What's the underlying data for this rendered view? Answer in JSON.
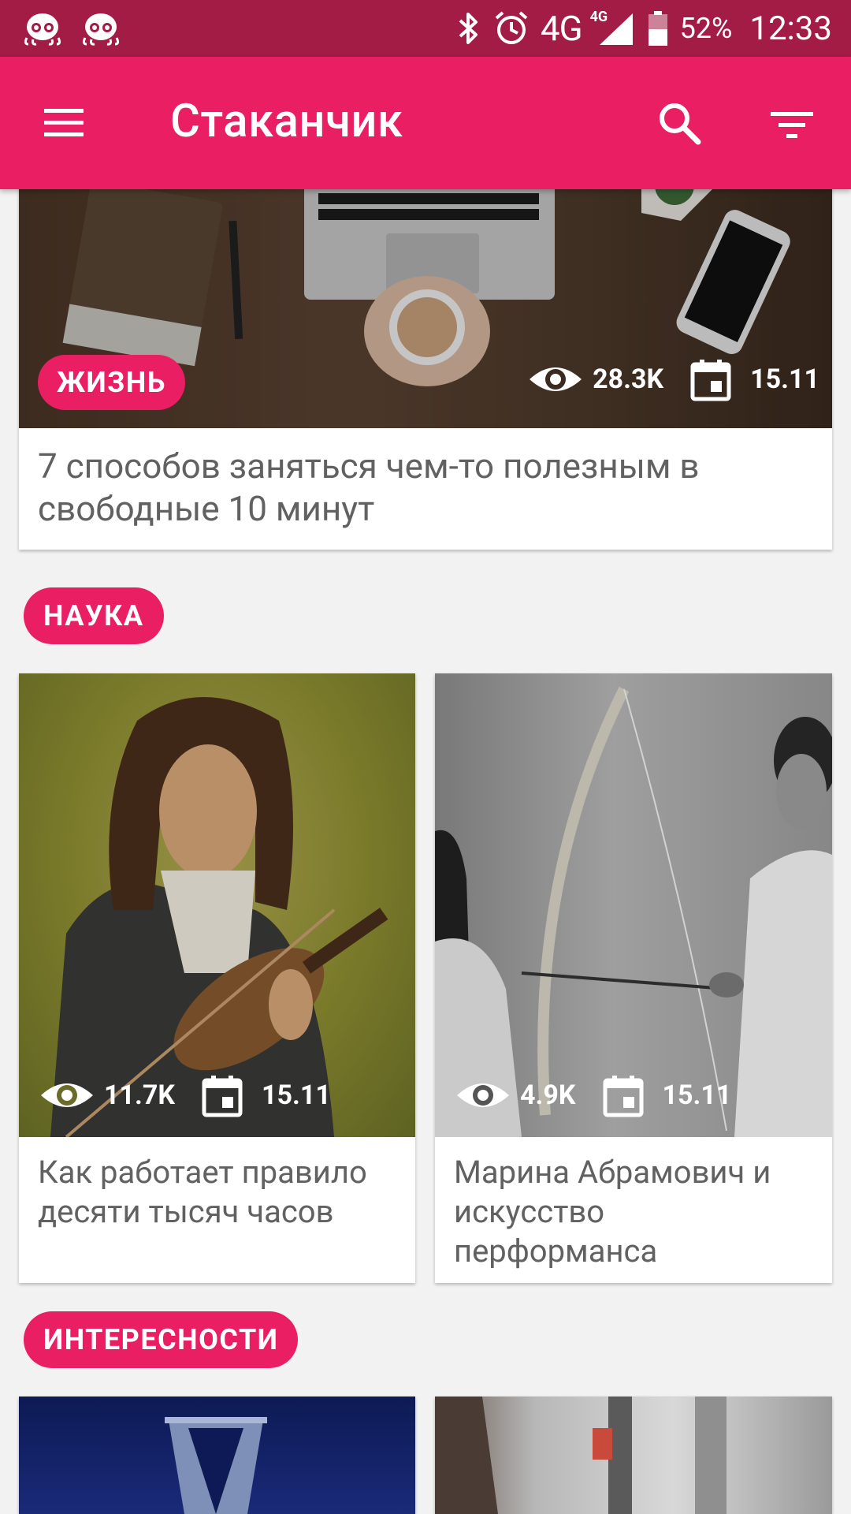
{
  "status_bar": {
    "network": "4G",
    "network_small": "4G",
    "battery_percent": "52%",
    "time": "12:33"
  },
  "toolbar": {
    "title": "Стаканчик"
  },
  "featured": {
    "category": "ЖИЗНЬ",
    "views": "28.3K",
    "date": "15.11",
    "title": "7 способов заняться чем-то полезным в свободные 10 минут"
  },
  "sections": [
    {
      "name": "НАУКА",
      "cards": [
        {
          "views": "11.7K",
          "date": "15.11",
          "title": "Как работает правило десяти тысяч часов"
        },
        {
          "views": "4.9K",
          "date": "15.11",
          "title": "Марина Абрамович и искусство перформанса"
        }
      ]
    },
    {
      "name": "ИНТЕРЕСНОСТИ",
      "cards": []
    }
  ],
  "colors": {
    "status_bar": "#a21c45",
    "accent": "#e91e63",
    "background": "#f2f2f2"
  }
}
